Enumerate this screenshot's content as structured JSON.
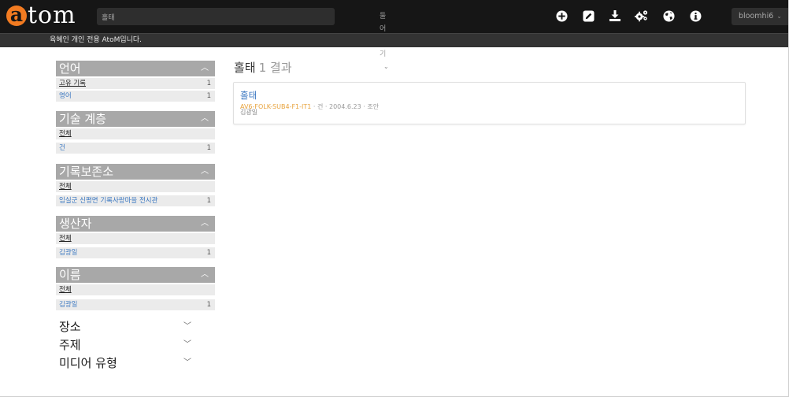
{
  "logo": {
    "initial": "a",
    "rest": "tom"
  },
  "search": {
    "value": "홀태"
  },
  "browse": {
    "label": "둘어보기",
    "chevron": "⌄"
  },
  "toolbar": {
    "icons": [
      "plus-circle-icon",
      "edit-icon",
      "download-icon",
      "gears-icon",
      "globe-icon",
      "info-icon"
    ],
    "user": "bloomhi6"
  },
  "notice": "육혜인 개인 전용 AtoM입니다.",
  "facets": {
    "language": {
      "title": "언어",
      "items": [
        {
          "label": "고유 기록",
          "count": "1"
        },
        {
          "label": "영어",
          "count": "1"
        }
      ]
    },
    "level": {
      "title": "기술 계층",
      "items": [
        {
          "label": "전체",
          "count": ""
        },
        {
          "label": "건",
          "count": "1"
        }
      ]
    },
    "repository": {
      "title": "기록보존소",
      "items": [
        {
          "label": "전체",
          "count": ""
        },
        {
          "label": "임실군 신평면 기록사랑마을 전시관",
          "count": "1"
        }
      ]
    },
    "creator": {
      "title": "생산자",
      "items": [
        {
          "label": "전체",
          "count": ""
        },
        {
          "label": "김광일",
          "count": "1"
        }
      ]
    },
    "name": {
      "title": "이름",
      "items": [
        {
          "label": "전체",
          "count": ""
        },
        {
          "label": "김광일",
          "count": "1"
        }
      ]
    },
    "place": {
      "title": "장소"
    },
    "subject": {
      "title": "주제"
    },
    "media": {
      "title": "미디어 유형"
    }
  },
  "results": {
    "title": "홀태",
    "count": "1 결과",
    "item": {
      "title": "홀태",
      "ref": "AV6-FOLK-SUB4-F1-IT1",
      "meta": " · 건 · 2004.6.23 · 조안",
      "creator": "김광일"
    }
  },
  "colors": {
    "accent": "#f27b21",
    "link": "#3a77c1",
    "facet_header": "#a8a8a8",
    "ref_orange": "#e8a33d"
  }
}
